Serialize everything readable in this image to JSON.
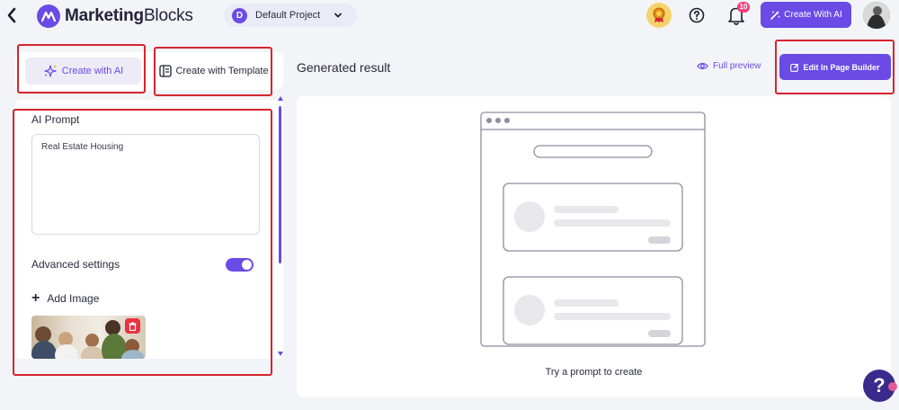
{
  "header": {
    "logo_bold": "Marketing",
    "logo_regular": "Blocks",
    "project": {
      "initial": "D",
      "name": "Default Project"
    },
    "notification_count": "10",
    "create_ai_label": "Create With AI"
  },
  "left": {
    "tabs": [
      {
        "label": "Create with AI",
        "active": true
      },
      {
        "label": "Create with Template",
        "active": false
      }
    ],
    "prompt_label": "AI Prompt",
    "prompt_value": "Real Estate Housing",
    "advanced_label": "Advanced settings",
    "advanced_enabled": true,
    "add_image_label": "Add Image"
  },
  "main": {
    "title": "Generated result",
    "full_preview_label": "Full preview",
    "edit_builder_label": "Edit In Page Builder",
    "empty_text": "Try a prompt to create"
  },
  "colors": {
    "accent": "#6a4be6",
    "highlight": "#d4252f"
  }
}
